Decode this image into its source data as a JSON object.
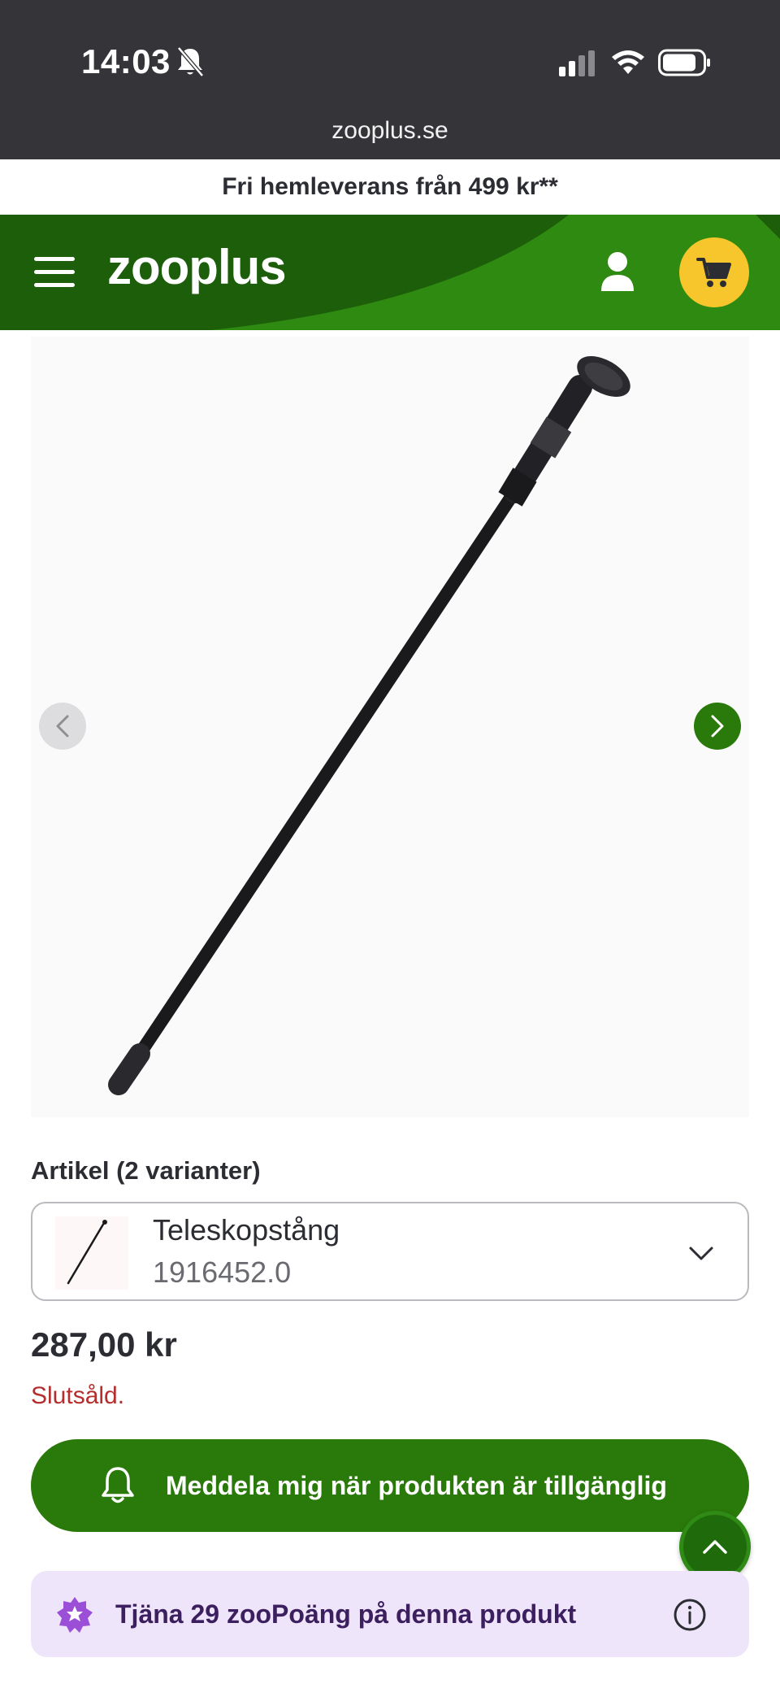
{
  "status_bar": {
    "time": "14:03",
    "url": "zooplus.se"
  },
  "promo": {
    "text": "Fri hemleverans från 499 kr**"
  },
  "header": {
    "logo_text": "zooplus"
  },
  "product": {
    "variant_label": "Artikel (2 varianter)",
    "variant_name": "Teleskopstång",
    "variant_sku": "1916452.0",
    "price": "287,00 kr",
    "availability": "Slutsåld.",
    "notify_label": "Meddela mig när produkten är tillgänglig",
    "points_label": "Tjäna 29 zooPoäng på denna produkt"
  },
  "colors": {
    "brand_green": "#2a7a0b",
    "cart_yellow": "#f6c62c",
    "soldout_red": "#b52d2d",
    "points_bg": "#efe5fa",
    "points_star": "#9b4fd6"
  },
  "icons": [
    "bell-off-icon",
    "signal-icon",
    "wifi-icon",
    "battery-icon",
    "menu-icon",
    "user-icon",
    "cart-icon",
    "chevron-left-icon",
    "chevron-right-icon",
    "chevron-down-icon",
    "bell-icon",
    "chevron-up-icon",
    "star-badge-icon",
    "info-icon"
  ]
}
